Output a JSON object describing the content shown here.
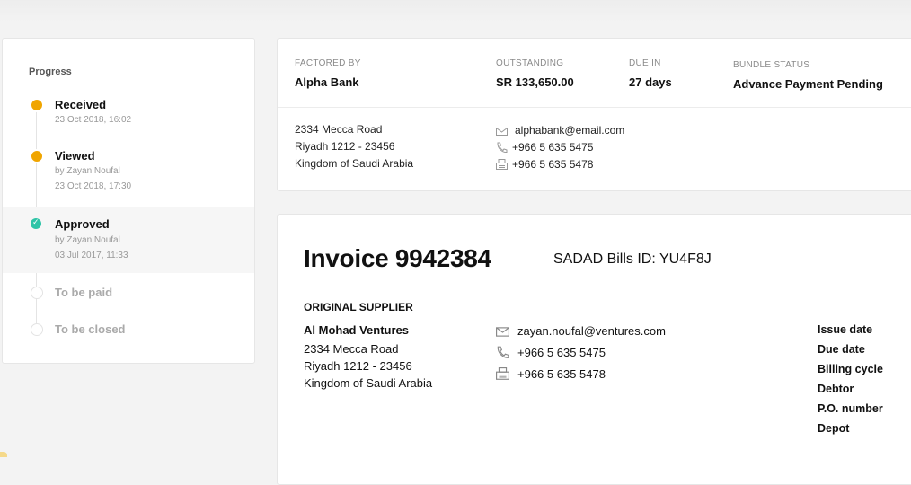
{
  "progress": {
    "title": "Progress",
    "steps": [
      {
        "title": "Received",
        "by": "",
        "date": "23 Oct 2018, 16:02",
        "state": "done"
      },
      {
        "title": "Viewed",
        "by": "by Zayan Noufal",
        "date": "23 Oct 2018, 17:30",
        "state": "done"
      },
      {
        "title": "Approved",
        "by": "by Zayan Noufal",
        "date": "03 Jul 2017, 11:33",
        "state": "current"
      },
      {
        "title": "To be paid",
        "by": "",
        "date": "",
        "state": "pending"
      },
      {
        "title": "To be closed",
        "by": "",
        "date": "",
        "state": "pending"
      }
    ]
  },
  "factor": {
    "factored_by_label": "FACTORED BY",
    "factored_by": "Alpha Bank",
    "outstanding_label": "OUTSTANDING",
    "outstanding": "SR 133,650.00",
    "due_in_label": "DUE IN",
    "due_in": "27 days",
    "bundle_status_label": "BUNDLE STATUS",
    "bundle_status": "Advance Payment Pending",
    "address": [
      "2334 Mecca Road",
      "Riyadh 1212 - 23456",
      "Kingdom of Saudi Arabia"
    ],
    "email": "alphabank@email.com",
    "phone": "+966 5 635 5475",
    "fax": "+966 5 635 5478"
  },
  "invoice": {
    "title": "Invoice 9942384",
    "sadad": "SADAD Bills ID:  YU4F8J",
    "section_head": "ORIGINAL SUPPLIER",
    "supplier_name": "Al Mohad Ventures",
    "address": [
      "2334 Mecca Road",
      "Riyadh 1212 - 23456",
      "Kingdom of Saudi Arabia"
    ],
    "email": "zayan.noufal@ventures.com",
    "phone": "+966 5 635 5475",
    "fax": "+966 5 635 5478",
    "meta_labels": [
      "Issue date",
      "Due date",
      "Billing cycle",
      "Debtor",
      "P.O. number",
      "Depot"
    ]
  },
  "colors": {
    "accent_orange": "#f0a500",
    "accent_green": "#2ec4a7"
  },
  "icons": {
    "email": "envelope-icon",
    "phone": "phone-icon",
    "fax": "fax-icon"
  }
}
